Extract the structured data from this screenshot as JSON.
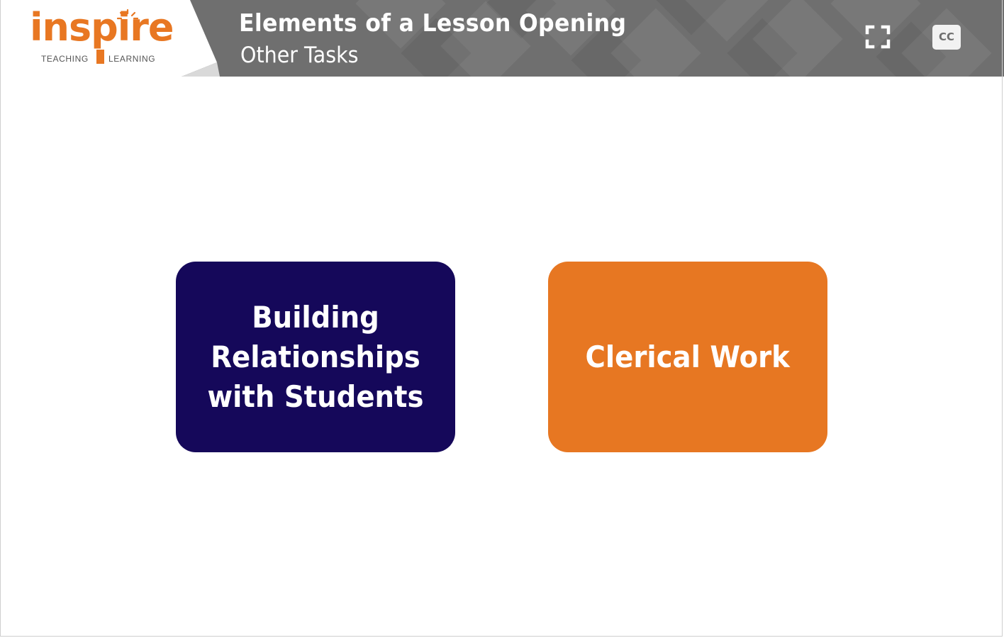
{
  "header": {
    "logo": {
      "wordmark": "inspire",
      "tagline_left": "TEACHING",
      "tagline_right": "LEARNING",
      "brand_color": "#e87722"
    },
    "title": "Elements of a Lesson Opening",
    "subtitle": "Other Tasks",
    "controls": {
      "fullscreen_icon": "fullscreen-icon",
      "captions_label": "CC"
    },
    "background_color": "#6f6f6f"
  },
  "cards": [
    {
      "label": "Building Relationships with Students",
      "color": "#15085a"
    },
    {
      "label": "Clerical Work",
      "color": "#e77722"
    }
  ]
}
